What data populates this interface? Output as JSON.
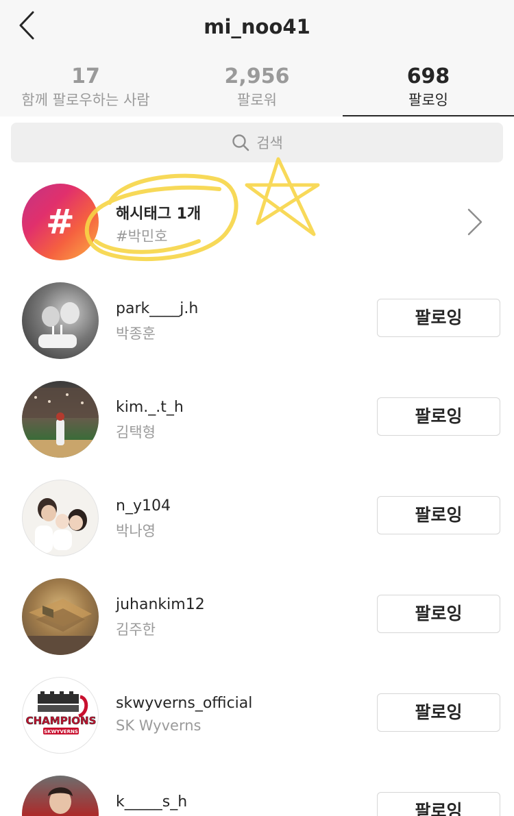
{
  "header": {
    "title": "mi_noo41"
  },
  "tabs": [
    {
      "count": "17",
      "label": "함께 팔로우하는 사람",
      "active": false
    },
    {
      "count": "2,956",
      "label": "팔로워",
      "active": false
    },
    {
      "count": "698",
      "label": "팔로잉",
      "active": true
    }
  ],
  "search": {
    "placeholder": "검색"
  },
  "hashtags": {
    "title": "해시태그 1개",
    "subtitle": "#박민호"
  },
  "following": [
    {
      "username": "park____j.h",
      "name": "박종훈",
      "button": "팔로잉"
    },
    {
      "username": "kim._.t_h",
      "name": "김택형",
      "button": "팔로잉"
    },
    {
      "username": "n_y104",
      "name": "박나영",
      "button": "팔로잉"
    },
    {
      "username": "juhankim12",
      "name": "김주한",
      "button": "팔로잉"
    },
    {
      "username": "skwyverns_official",
      "name": "SK Wyverns",
      "button": "팔로잉"
    },
    {
      "username": "k_____s_h",
      "name": "",
      "button": "팔로잉"
    }
  ],
  "logo": {
    "text": "CHAMPIONS",
    "subtext": "SKWYVERNS"
  },
  "colors": {
    "accent_text": "#262626",
    "muted_text": "#9a9a9a",
    "highlighter": "#f7d547"
  },
  "icons": {
    "back": "chevron-left-icon",
    "search": "search-icon",
    "hashtag": "hashtag-icon",
    "forward": "chevron-right-icon"
  }
}
